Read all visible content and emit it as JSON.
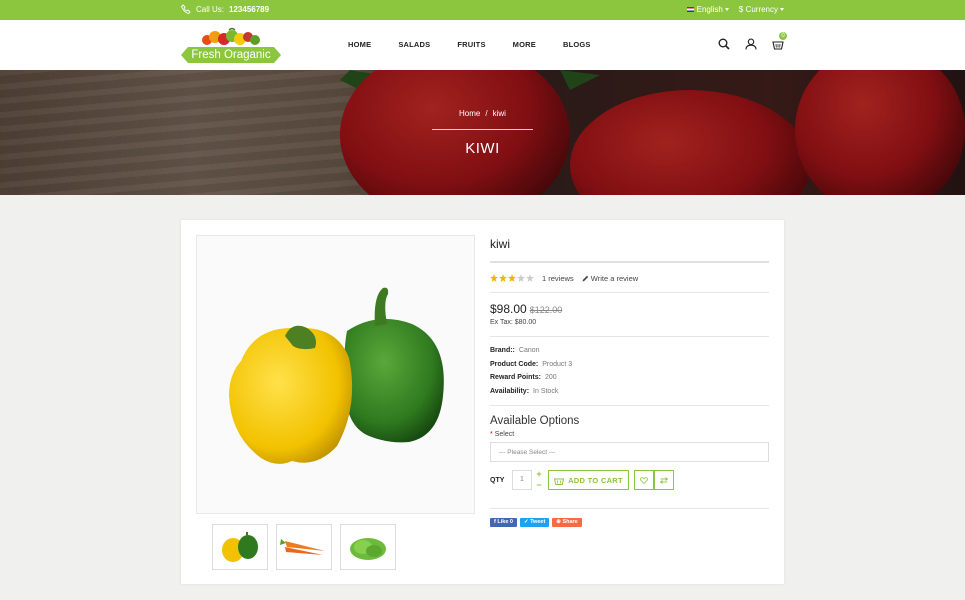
{
  "topbar": {
    "phone_label": "Call Us:",
    "phone_number": "123456789",
    "language": "English",
    "currency": "$ Currency"
  },
  "header": {
    "logo_text": "Fresh Oraganic",
    "nav": [
      "HOME",
      "SALADS",
      "FRUITS",
      "MORE",
      "BLOGS"
    ],
    "cart_count": "0"
  },
  "banner": {
    "breadcrumb": [
      "Home",
      "kiwi"
    ],
    "separator": "/",
    "title": "KIWI"
  },
  "product": {
    "name": "kiwi",
    "rating": 3,
    "rating_max": 5,
    "reviews_text": "1 reviews",
    "write_review": "Write a review",
    "price": "$98.00",
    "old_price": "$122.00",
    "ex_tax": "Ex Tax: $80.00",
    "specs": [
      {
        "label": "Brand::",
        "value": "Canon"
      },
      {
        "label": "Product Code:",
        "value": "Product 3"
      },
      {
        "label": "Reward Points:",
        "value": "200"
      },
      {
        "label": "Availability:",
        "value": "In Stock"
      }
    ],
    "options_title": "Available Options",
    "select_label": "Select",
    "select_placeholder": " --- Please Select --- ",
    "qty_label": "QTY",
    "qty_value": "1",
    "add_to_cart": "ADD TO CART",
    "share": {
      "facebook": "Like 0",
      "twitter": "Tweet",
      "share": "Share"
    }
  },
  "colors": {
    "accent": "#8cc63f",
    "star": "#f5b301"
  }
}
